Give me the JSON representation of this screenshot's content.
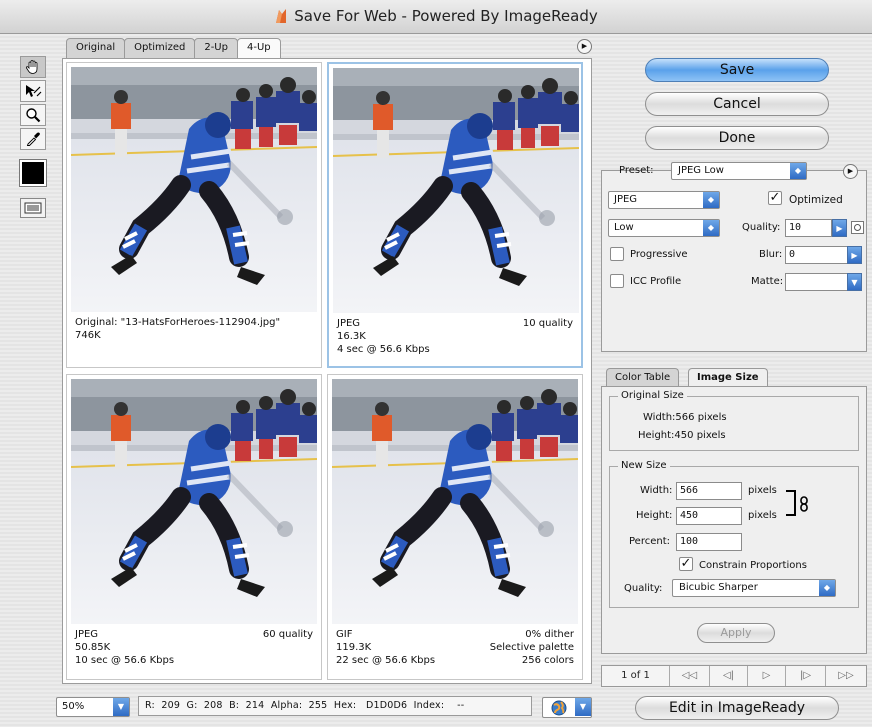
{
  "window": {
    "title": "Save For Web - Powered By ImageReady"
  },
  "toolbox": {
    "tools": [
      "hand-tool",
      "slice-select-tool",
      "zoom-tool",
      "eyedropper-tool"
    ],
    "eyedropper_color": "#000000"
  },
  "tabs": [
    "Original",
    "Optimized",
    "2-Up",
    "4-Up"
  ],
  "active_tab": "4-Up",
  "panes": [
    {
      "line1_left": "Original: \"13-HatsForHeroes-112904.jpg\"",
      "line1_right": "",
      "line2_left": "746K",
      "line2_right": "",
      "line3_left": "",
      "line3_right": ""
    },
    {
      "line1_left": "JPEG",
      "line1_right": "10 quality",
      "line2_left": "16.3K",
      "line2_right": "",
      "line3_left": "4 sec @ 56.6 Kbps",
      "line3_right": ""
    },
    {
      "line1_left": "JPEG",
      "line1_right": "60 quality",
      "line2_left": "50.85K",
      "line2_right": "",
      "line3_left": "10 sec @ 56.6 Kbps",
      "line3_right": ""
    },
    {
      "line1_left": "GIF",
      "line1_right": "0% dither",
      "line2_left": "119.3K",
      "line2_right": "Selective palette",
      "line3_left": "22 sec @ 56.6 Kbps",
      "line3_right": "256 colors"
    }
  ],
  "status": {
    "zoom": "50%",
    "readout": "R:  209  G:  208  B:  214  Alpha:  255  Hex:   D1D0D6  Index:    --"
  },
  "buttons": {
    "save": "Save",
    "cancel": "Cancel",
    "done": "Done",
    "edit": "Edit in ImageReady",
    "apply": "Apply"
  },
  "optimize": {
    "preset_label": "Preset:",
    "preset_value": "JPEG Low",
    "format": "JPEG",
    "compression": "Low",
    "optimized_label": "Optimized",
    "optimized_checked": true,
    "quality_label": "Quality:",
    "quality_value": "10",
    "progressive_label": "Progressive",
    "blur_label": "Blur:",
    "blur_value": "0",
    "icc_label": "ICC Profile",
    "matte_label": "Matte:"
  },
  "panel_tabs": [
    "Color Table",
    "Image Size"
  ],
  "image_size": {
    "original_title": "Original Size",
    "orig_width": "Width:566 pixels",
    "orig_height": "Height:450 pixels",
    "new_title": "New Size",
    "width_label": "Width:",
    "width_value": "566",
    "height_label": "Height:",
    "height_value": "450",
    "percent_label": "Percent:",
    "percent_value": "100",
    "units": "pixels",
    "constrain_label": "Constrain Proportions",
    "constrain_checked": true,
    "quality_label": "Quality:",
    "quality_value": "Bicubic Sharper"
  },
  "navigation": {
    "page": "1 of 1",
    "first": "◁◁",
    "prev": "◁|",
    "play": "▷",
    "next": "|▷",
    "last": "▷▷"
  }
}
